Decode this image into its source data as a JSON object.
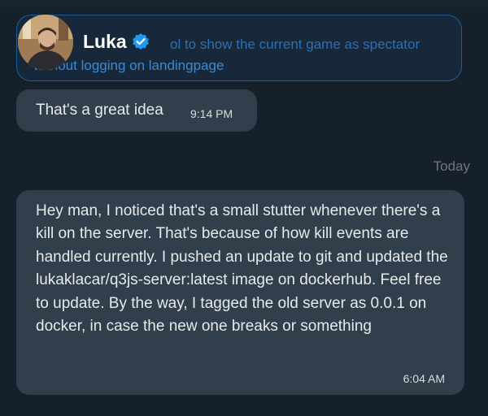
{
  "conversation": {
    "contact_name": "Luka",
    "verified": true
  },
  "quoted_message": {
    "line1": "ol to show the current game as spectator",
    "line2": "without logging on landingpage"
  },
  "messages": [
    {
      "text": "That's a great idea",
      "time": "9:14 PM"
    },
    {
      "text": "Hey man, I noticed that's a small stutter whenever there's a kill on the server. That's because of how kill events are handled currently. I pushed an update to git and updated the lukaklacar/q3js-server:latest image on dockerhub. Feel free to update. By the way, I tagged the old server as 0.0.1 on docker, in case the new one breaks or something",
      "time": "6:04 AM"
    }
  ],
  "day_divider": "Today",
  "colors": {
    "background": "#15202b",
    "bubble": "#303f4b",
    "accent": "#1d9bf0"
  }
}
